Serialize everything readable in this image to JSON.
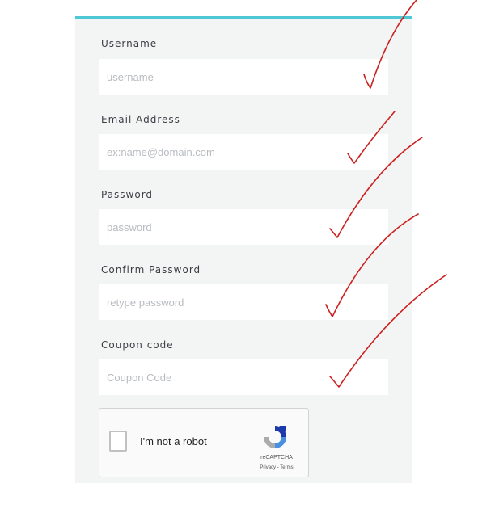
{
  "form": {
    "fields": [
      {
        "label": "Username",
        "placeholder": "username"
      },
      {
        "label": "Email Address",
        "placeholder": "ex:name@domain.com"
      },
      {
        "label": "Password",
        "placeholder": "password"
      },
      {
        "label": "Confirm Password",
        "placeholder": "retype password"
      },
      {
        "label": "Coupon code",
        "placeholder": "Coupon Code"
      }
    ]
  },
  "captcha": {
    "label": "I'm not a robot",
    "brand": "reCAPTCHA",
    "links": "Privacy - Terms"
  },
  "colors": {
    "accent": "#4fc8d6",
    "card_background": "#f3f5f4",
    "annotation": "#cc1f1f"
  }
}
